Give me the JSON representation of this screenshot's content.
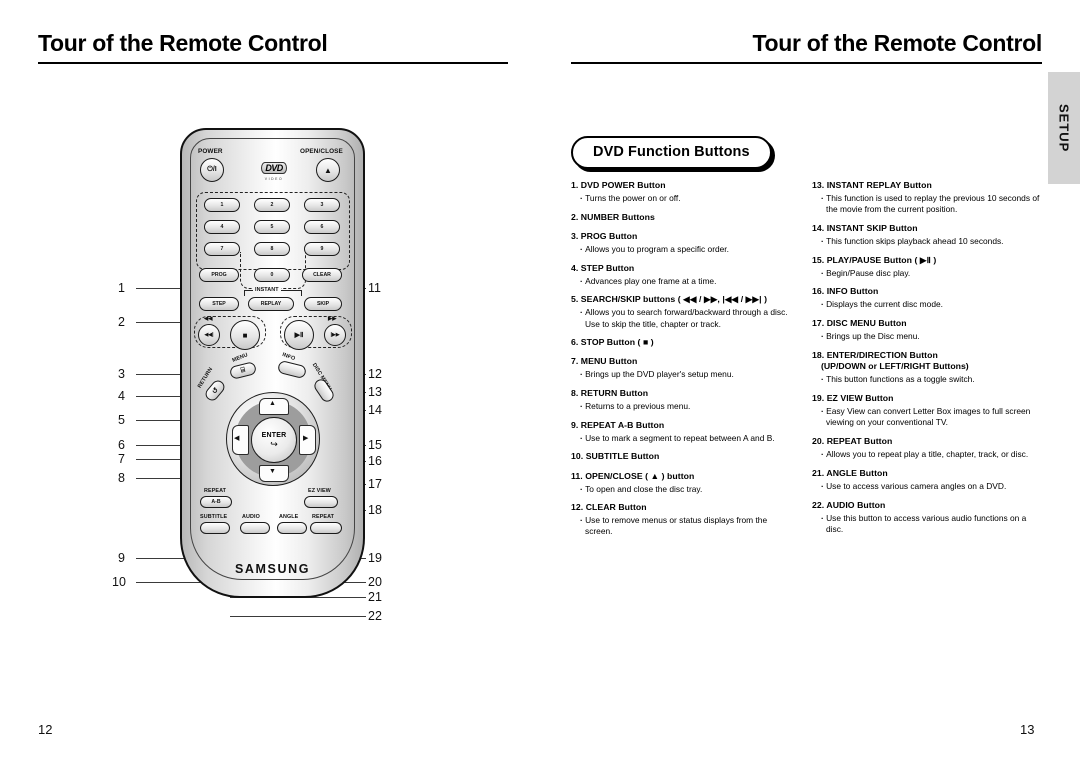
{
  "left_page": {
    "title": "Tour of the Remote Control",
    "page_number": "12",
    "callouts_left": [
      "1",
      "2",
      "3",
      "4",
      "5",
      "6",
      "7",
      "8",
      "9",
      "10"
    ],
    "callouts_right": [
      "11",
      "12",
      "13",
      "14",
      "15",
      "16",
      "17",
      "18",
      "19",
      "20",
      "21",
      "22"
    ],
    "remote": {
      "brand": "SAMSUNG",
      "power_label": "POWER",
      "power_glyph": "⏻/I",
      "open_close_label": "OPEN/CLOSE",
      "open_close_glyph": "▲",
      "disc_logo_main": "DVD",
      "disc_logo_sub": "VIDEO",
      "number_keys": [
        "1",
        "2",
        "3",
        "4",
        "5",
        "6",
        "7",
        "8",
        "9",
        "0"
      ],
      "prog_label": "PROG",
      "clear_label": "CLEAR",
      "instant_label": "INSTANT",
      "step_label": "STEP",
      "replay_label": "REPLAY",
      "skip_label": "SKIP",
      "search_back_glyph": "◀◀",
      "search_fwd_glyph": "▶▶",
      "skip_back_glyph": "◀◀|",
      "skip_fwd_glyph": "|▶▶",
      "stop_glyph": "■",
      "play_pause_glyph": "▶Ⅱ",
      "menu_label": "MENU",
      "menu_glyph": "⌸",
      "info_label": "INFO",
      "return_label": "RETURN",
      "return_glyph": "↺",
      "disc_menu_label": "DISC MENU",
      "enter_label": "ENTER",
      "enter_glyph": "↪",
      "nav_up": "▲",
      "nav_down": "▼",
      "nav_left": "◀",
      "nav_right": "▶",
      "repeat_ab_label_1": "REPEAT",
      "repeat_ab_label_2": "A-B",
      "ez_view_label": "EZ VIEW",
      "subtitle_label": "SUBTITLE",
      "audio_label": "AUDIO",
      "angle_label": "ANGLE",
      "repeat_label": "REPEAT"
    }
  },
  "right_page": {
    "title": "Tour of the Remote Control",
    "page_number": "13",
    "side_tab": "SETUP",
    "section_title": "DVD Function Buttons",
    "column_1": [
      {
        "num": "1.",
        "head": "DVD POWER Button",
        "bullets": [
          "Turns the power on or off."
        ]
      },
      {
        "num": "2.",
        "head": "NUMBER Buttons",
        "bullets": []
      },
      {
        "num": "3.",
        "head": "PROG Button",
        "bullets": [
          "Allows you to program a specific order."
        ]
      },
      {
        "num": "4.",
        "head": "STEP Button",
        "bullets": [
          "Advances play one frame at a time."
        ]
      },
      {
        "num": "5.",
        "head": "SEARCH/SKIP buttons ( ◀◀ / ▶▶, |◀◀ / ▶▶| )",
        "bullets": [
          "Allows you to search forward/backward through a disc. Use to skip the title, chapter or track."
        ]
      },
      {
        "num": "6.",
        "head": "STOP Button ( ■ )",
        "bullets": []
      },
      {
        "num": "7.",
        "head": "MENU Button",
        "bullets": [
          "Brings up the DVD player's setup menu."
        ]
      },
      {
        "num": "8.",
        "head": "RETURN Button",
        "bullets": [
          "Returns to a previous menu."
        ]
      },
      {
        "num": "9.",
        "head": "REPEAT A-B Button",
        "bullets": [
          "Use to mark a segment to repeat between A and B."
        ]
      },
      {
        "num": "10.",
        "head": "SUBTITLE Button",
        "bullets": []
      },
      {
        "num": "11.",
        "head": "OPEN/CLOSE ( ▲ ) button",
        "bullets": [
          "To open and close the disc tray."
        ]
      },
      {
        "num": "12.",
        "head": "CLEAR Button",
        "bullets": [
          "Use to remove menus or status displays from the screen."
        ]
      }
    ],
    "column_2": [
      {
        "num": "13.",
        "head": "INSTANT REPLAY Button",
        "bullets": [
          "This function is used to replay the previous 10 seconds of the movie from the current position."
        ]
      },
      {
        "num": "14.",
        "head": "INSTANT SKIP Button",
        "bullets": [
          "This function skips playback ahead 10 seconds."
        ]
      },
      {
        "num": "15.",
        "head": "PLAY/PAUSE Button ( ▶Ⅱ )",
        "bullets": [
          "Begin/Pause disc play."
        ]
      },
      {
        "num": "16.",
        "head": "INFO Button",
        "bullets": [
          "Displays the current disc mode."
        ]
      },
      {
        "num": "17.",
        "head": "DISC MENU Button",
        "bullets": [
          "Brings up the Disc menu."
        ]
      },
      {
        "num": "18.",
        "head": "ENTER/DIRECTION Button",
        "sub": "(UP/DOWN or LEFT/RIGHT Buttons)",
        "bullets": [
          "This button functions as a toggle switch."
        ]
      },
      {
        "num": "19.",
        "head": "EZ VIEW Button",
        "bullets": [
          "Easy View can convert Letter Box images to full screen viewing on your conventional TV."
        ]
      },
      {
        "num": "20.",
        "head": "REPEAT Button",
        "bullets": [
          "Allows you to repeat play a title, chapter, track, or disc."
        ]
      },
      {
        "num": "21.",
        "head": "ANGLE Button",
        "bullets": [
          "Use to access various camera angles on a DVD."
        ]
      },
      {
        "num": "22.",
        "head": "AUDIO Button",
        "bullets": [
          "Use this button to access various audio functions on a disc."
        ]
      }
    ]
  }
}
